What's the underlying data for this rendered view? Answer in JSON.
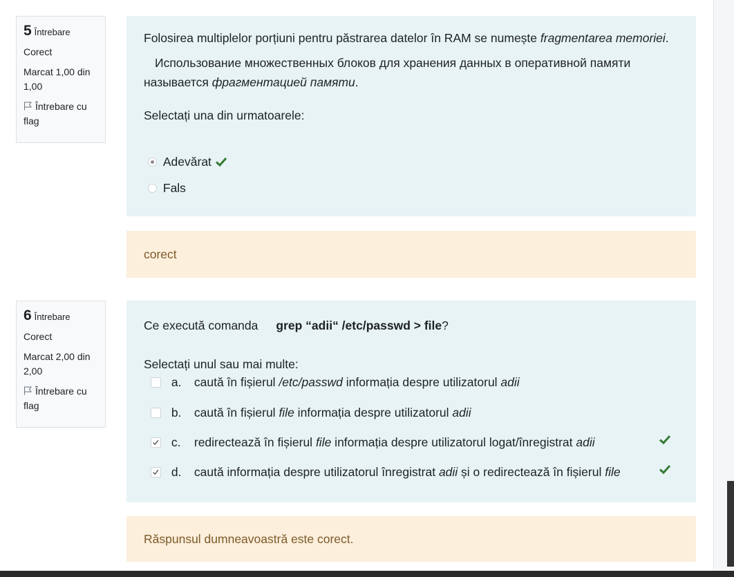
{
  "q5": {
    "number": "5",
    "word": "Întrebare",
    "state": "Corect",
    "mark": "Marcat 1,00 din 1,00",
    "flag_label": "Întrebare cu flag",
    "text_ro_a": "Folosirea multiplelor porțiuni pentru păstrarea datelor în RAM se numește ",
    "text_ro_em": "fragmentarea memoriei",
    "text_ro_b": ".",
    "text_ru_a": "Использование множественных блоков для хранения данных в оперативной памяти называется ",
    "text_ru_em": "фрагментацией памяти",
    "text_ru_b": ".",
    "prompt": "Selectați una din urmatoarele:",
    "options": [
      "Adevărat",
      "Fals"
    ],
    "feedback": "corect"
  },
  "q6": {
    "number": "6",
    "word": "Întrebare",
    "state": "Corect",
    "mark": "Marcat 2,00 din 2,00",
    "flag_label": "Întrebare cu flag",
    "text_a": "Ce execută comanda",
    "text_cmd": "grep “adii“ /etc/passwd > file",
    "text_b": "?",
    "prompt": "Selectați unul sau mai multe:",
    "options": [
      {
        "letter": "a.",
        "t1": "caută în fișierul ",
        "e1": "/etc/passwd",
        "t2": " informația despre utilizatorul ",
        "e2": "adii",
        "t3": ""
      },
      {
        "letter": "b.",
        "t1": "caută în fișierul ",
        "e1": "file",
        "t2": " informația despre utilizatorul ",
        "e2": "adii",
        "t3": ""
      },
      {
        "letter": "c.",
        "t1": "redirectează în fișierul ",
        "e1": "file",
        "t2": " informația despre utilizatorul logat/înregistrat ",
        "e2": "adii",
        "t3": ""
      },
      {
        "letter": "d.",
        "t1": "caută informația despre utilizatorul înregistrat ",
        "e1": "adii",
        "t2": " și o redirectează în fișierul ",
        "e2": "file",
        "t3": ""
      }
    ],
    "feedback": "Răspunsul dumneavoastră este corect."
  },
  "colors": {
    "correct": "#357a32",
    "question_bg": "#e7f3f5",
    "feedback_bg": "#fcefdc",
    "feedback_text": "#7d5a29"
  }
}
